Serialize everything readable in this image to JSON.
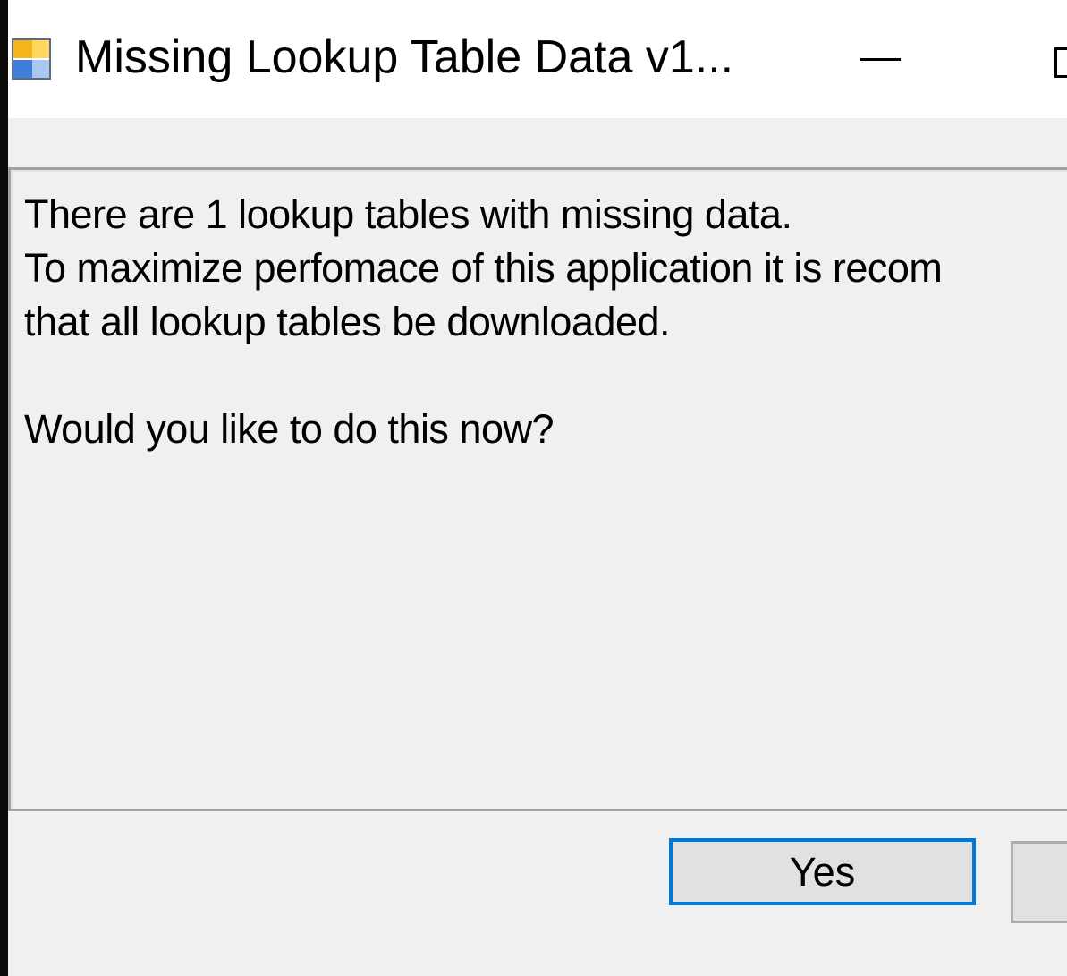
{
  "window": {
    "title": "Missing Lookup Table Data v1..."
  },
  "message": {
    "lines": [
      "There are 1 lookup tables with missing data.",
      "To maximize perfomace of this application it is recom",
      "that all lookup tables be downloaded.",
      "",
      "Would you like to do this now?"
    ]
  },
  "buttons": {
    "yes_label": "Yes",
    "no_label": ""
  },
  "colors": {
    "accent": "#0078d7",
    "window_bg": "#f0f0f0",
    "titlebar_bg": "#ffffff"
  },
  "icons": {
    "app": "app-window-icon",
    "minimize": "minimize-icon",
    "maximize": "maximize-icon"
  }
}
